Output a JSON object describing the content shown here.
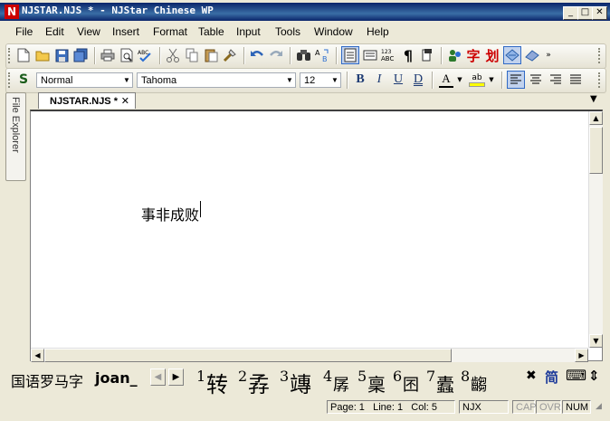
{
  "window": {
    "title": "NJSTAR.NJS * - NJStar Chinese WP",
    "icon_letter": "N",
    "minimize": "_",
    "maximize": "□",
    "close": "✕"
  },
  "menu": [
    "File",
    "Edit",
    "View",
    "Insert",
    "Format",
    "Table",
    "Input",
    "Tools",
    "Window",
    "Help"
  ],
  "toolbar_icons": [
    "new-document",
    "open-folder",
    "save",
    "save-all",
    "print",
    "print-preview",
    "spell-check",
    "cut",
    "copy",
    "paste",
    "format-painter",
    "undo",
    "redo",
    "find",
    "replace",
    "view-page",
    "view-normal",
    "view-code",
    "paragraph-marks",
    "outline",
    "contacts",
    "character",
    "stroke",
    "input-mode",
    "eraser"
  ],
  "format": {
    "style": "Normal",
    "font": "Tahoma",
    "size": "12",
    "bold": "B",
    "italic": "I",
    "underline": "U",
    "double_underline": "D",
    "font_color_letter": "A",
    "highlight_letter": "ab",
    "font_color": "#000000",
    "highlight_color": "#ffff00"
  },
  "side_panel": {
    "label": "File Explorer"
  },
  "tab": {
    "label": "NJSTAR.NJS *",
    "close": "✕"
  },
  "document": {
    "text": "事非成败"
  },
  "ime": {
    "method": "国语罗马字",
    "pinyin": "joan_",
    "candidates": [
      {
        "num": "1",
        "ch": "转"
      },
      {
        "num": "2",
        "ch": "孨"
      },
      {
        "num": "3",
        "ch": "竱"
      },
      {
        "num": "4",
        "ch": "孱"
      },
      {
        "num": "5",
        "ch": "稟"
      },
      {
        "num": "6",
        "ch": "囨"
      },
      {
        "num": "7",
        "ch": "蠹"
      },
      {
        "num": "8",
        "ch": "齺"
      }
    ],
    "close": "✖",
    "simplified": "简",
    "keyboard": "⌨",
    "toggle": "⇕"
  },
  "status": {
    "page": "Page: 1",
    "line": "Line: 1",
    "col": "Col: 5",
    "mode": "NJX",
    "caps": "CAP",
    "ovr": "OVR",
    "num": "NUM"
  }
}
